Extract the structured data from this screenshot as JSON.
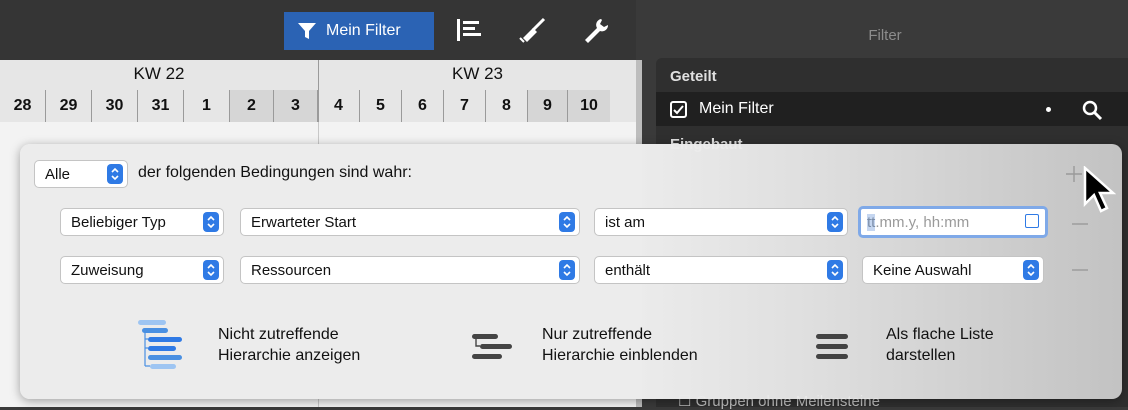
{
  "toolbar": {
    "filter_label": "Mein Filter",
    "icons": [
      "funnel-icon",
      "gantt-icon",
      "broom-icon",
      "wrench-icon"
    ]
  },
  "calendar": {
    "weeks": [
      "KW 22",
      "KW 23"
    ],
    "days": [
      "28",
      "29",
      "30",
      "31",
      "1",
      "2",
      "3",
      "4",
      "5",
      "6",
      "7",
      "8",
      "9",
      "10"
    ]
  },
  "panel": {
    "title": "Filter",
    "shared_header": "Geteilt",
    "my_filter_label": "Mein Filter",
    "my_filter_checked": true,
    "builtin_header": "Eingebaut",
    "bottom_item": "Gruppen ohne Meilensteine"
  },
  "popover": {
    "match_value": "Alle",
    "match_text": "der folgenden Bedingungen sind wahr:",
    "rows": [
      {
        "type": "Beliebiger Typ",
        "field": "Erwarteter Start",
        "operator": "ist am",
        "value_placeholder_hl": "tt",
        "value_placeholder": ".mm.y, hh:mm"
      },
      {
        "type": "Zuweisung",
        "field": "Ressourcen",
        "operator": "enthält",
        "value": "Keine Auswahl"
      }
    ],
    "options": [
      {
        "label": "Nicht zutreffende\nHierarchie anzeigen",
        "icon": "hierarchy-all-icon"
      },
      {
        "label": "Nur zutreffende\nHierarchie einblenden",
        "icon": "hierarchy-matching-icon"
      },
      {
        "label": "Als flache Liste\ndarstellen",
        "icon": "flat-list-icon"
      }
    ]
  },
  "colors": {
    "accent": "#2f7ae5",
    "toolbar_selected": "#2b63b4",
    "sidebar_bg": "#2f2f2f"
  }
}
